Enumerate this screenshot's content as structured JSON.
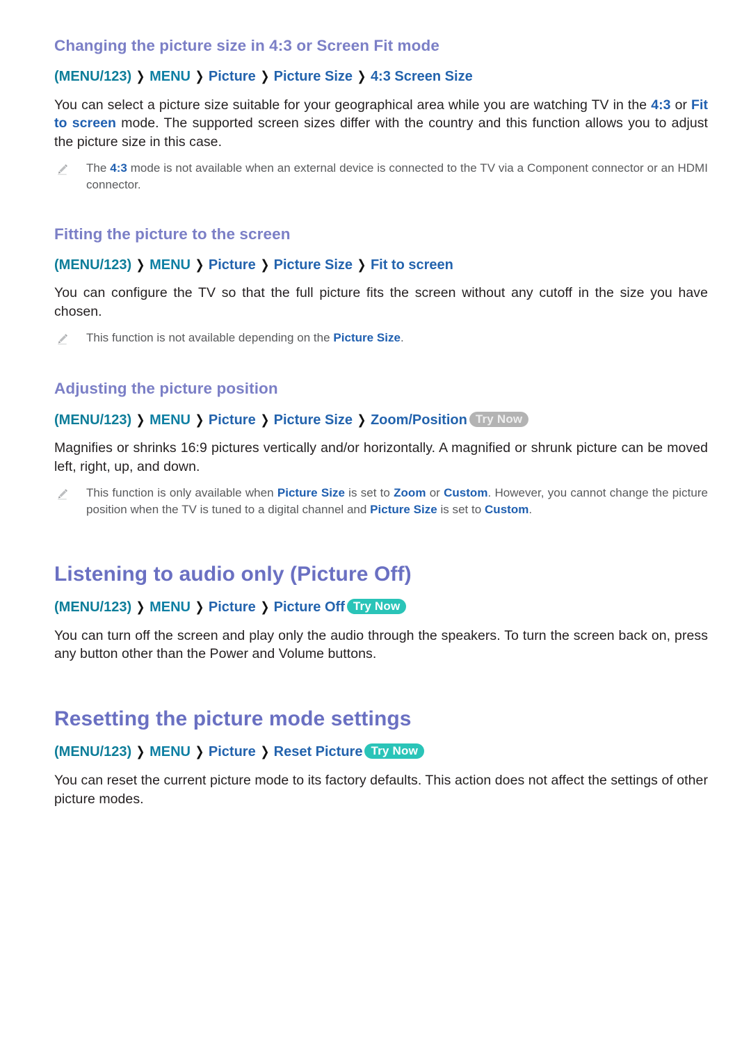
{
  "sections": [
    {
      "id": "changing-picture-size",
      "level": "h2",
      "heading": "Changing the picture size in 4:3 or Screen Fit mode",
      "breadcrumb": {
        "menu123": "MENU/123",
        "menu": "MENU",
        "items": [
          "Picture",
          "Picture Size",
          "4:3 Screen Size"
        ],
        "separator": "›",
        "trynow": null
      },
      "paragraph": {
        "part1": "You can select a picture size suitable for your geographical area while you are watching TV in the ",
        "hl1": "4:3",
        "part2": " or ",
        "hl2": "Fit to screen",
        "part3": " mode. The supported screen sizes differ with the country and this function allows you to adjust the picture size in this case."
      },
      "notes": [
        {
          "icon": "pencil-icon",
          "part1": "The ",
          "hl1": "4:3",
          "part2": " mode is not available when an external device is connected to the TV via a Component connector or an HDMI connector."
        }
      ]
    },
    {
      "id": "fitting-picture",
      "level": "h2",
      "heading": "Fitting the picture to the screen",
      "breadcrumb": {
        "menu123": "MENU/123",
        "menu": "MENU",
        "items": [
          "Picture",
          "Picture Size",
          "Fit to screen"
        ],
        "separator": "›",
        "trynow": null
      },
      "paragraph": {
        "part1": "You can configure the TV so that the full picture fits the screen without any cutoff in the size you have chosen.",
        "hl1": "",
        "part2": "",
        "hl2": "",
        "part3": ""
      },
      "notes": [
        {
          "icon": "pencil-icon",
          "part1": "This function is not available depending on the ",
          "hl1": "Picture Size",
          "part2": "."
        }
      ]
    },
    {
      "id": "adjusting-position",
      "level": "h2",
      "heading": "Adjusting the picture position",
      "breadcrumb": {
        "menu123": "MENU/123",
        "menu": "MENU",
        "items": [
          "Picture",
          "Picture Size",
          "Zoom/Position"
        ],
        "separator": "›",
        "trynow": {
          "label": "Try Now",
          "style": "gray"
        }
      },
      "paragraph": {
        "part1": "Magnifies or shrinks 16:9 pictures vertically and/or horizontally. A magnified or shrunk picture can be moved left, right, up, and down.",
        "hl1": "",
        "part2": "",
        "hl2": "",
        "part3": ""
      },
      "notes": [
        {
          "icon": "pencil-icon",
          "part1": "This function is only available when ",
          "hl1": "Picture Size",
          "part2": " is set to ",
          "hl2": "Zoom",
          "part3": " or ",
          "hl3": "Custom",
          "part4": ". However, you cannot change the picture position when the TV is tuned to a digital channel and ",
          "hl4": "Picture Size",
          "part5": " is set to ",
          "hl5": "Custom",
          "part6": "."
        }
      ]
    },
    {
      "id": "listening-audio-only",
      "level": "h1",
      "heading": "Listening to audio only (Picture Off)",
      "breadcrumb": {
        "menu123": "MENU/123",
        "menu": "MENU",
        "items": [
          "Picture",
          "Picture Off"
        ],
        "separator": "›",
        "trynow": {
          "label": "Try Now",
          "style": "teal"
        }
      },
      "paragraph": {
        "part1": "You can turn off the screen and play only the audio through the speakers. To turn the screen back on, press any button other than the Power and Volume buttons.",
        "hl1": "",
        "part2": "",
        "hl2": "",
        "part3": ""
      },
      "notes": []
    },
    {
      "id": "resetting-picture-mode",
      "level": "h1",
      "heading": "Resetting the picture mode settings",
      "breadcrumb": {
        "menu123": "MENU/123",
        "menu": "MENU",
        "items": [
          "Picture",
          "Reset Picture"
        ],
        "separator": "›",
        "trynow": {
          "label": "Try Now",
          "style": "teal"
        }
      },
      "paragraph": {
        "part1": "You can reset the current picture mode to its factory defaults. This action does not affect the settings of other picture modes.",
        "hl1": "",
        "part2": "",
        "hl2": "",
        "part3": ""
      },
      "notes": []
    }
  ],
  "colors": {
    "heading_purple": "#6a70c2",
    "subheading_purple": "#7b7fc6",
    "breadcrumb_teal": "#0d7d99",
    "breadcrumb_blue": "#2363ad",
    "inline_highlight_blue": "#1f5fb0",
    "badge_teal": "#2ac4b8",
    "badge_gray": "#b3b3b3",
    "body_text": "#231f20",
    "note_text": "#58595b"
  },
  "icons": {
    "pencil": "pencil-icon",
    "chevron": "chevron-right-icon"
  }
}
